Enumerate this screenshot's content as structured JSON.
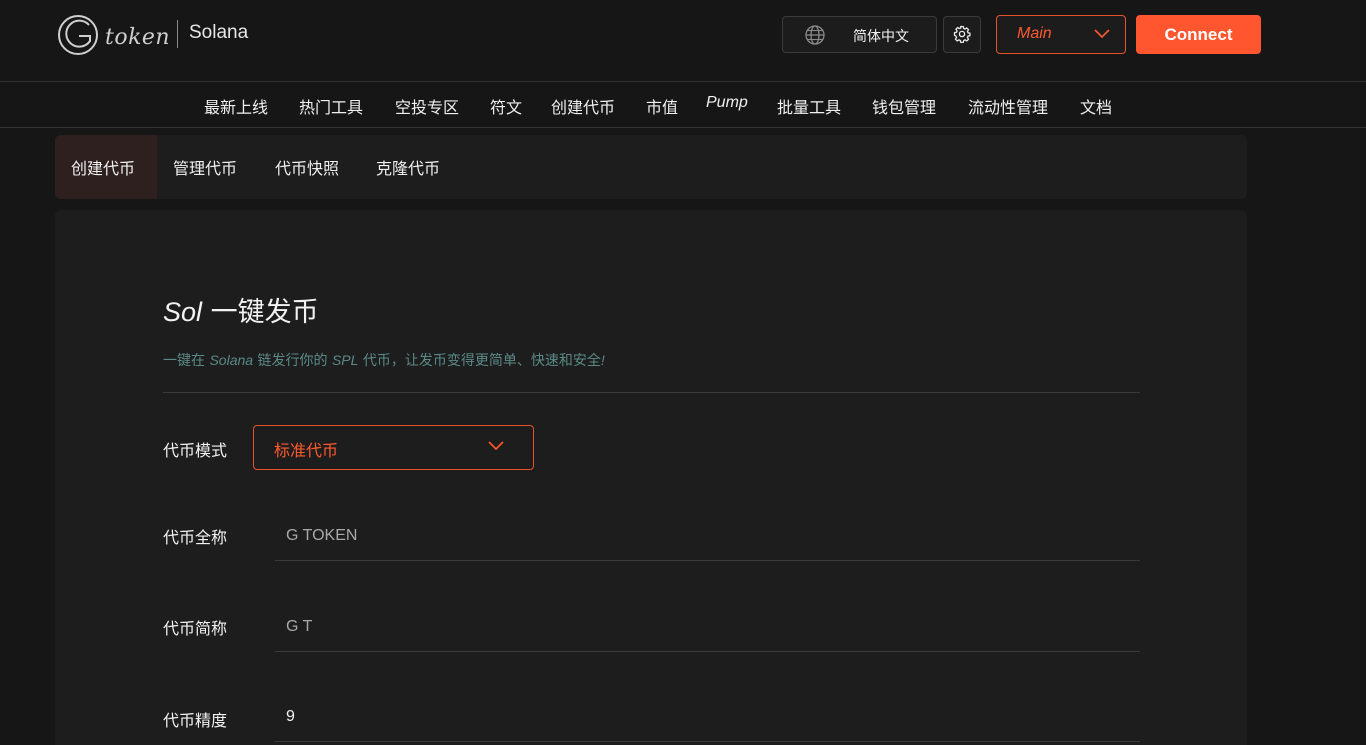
{
  "header": {
    "logo_text": "token",
    "chain": "Solana",
    "language": "简体中文",
    "network": "Main",
    "connect_label": "Connect"
  },
  "nav": {
    "items": [
      "最新上线",
      "热门工具",
      "空投专区",
      "符文",
      "创建代币",
      "市值",
      "Pump",
      "批量工具",
      "钱包管理",
      "流动性管理",
      "文档"
    ]
  },
  "subtabs": [
    "创建代币",
    "管理代币",
    "代币快照",
    "克隆代币"
  ],
  "form": {
    "title_prefix": "Sol",
    "title_rest": " 一键发币",
    "subtitle_a": "一键在 ",
    "subtitle_chain": "Solana",
    "subtitle_b": " 链发行你的 ",
    "subtitle_spl": "SPL",
    "subtitle_c": " 代币，让发币变得更简单、快速和安全",
    "subtitle_end": "!",
    "mode_label": "代币模式",
    "mode_value": "标准代币",
    "name_label": "代币全称",
    "name_placeholder": "G TOKEN",
    "symbol_label": "代币简称",
    "symbol_placeholder": "G T",
    "decimals_label": "代币精度",
    "decimals_value": "9"
  },
  "colors": {
    "accent": "#ff5630",
    "background": "#161616",
    "card": "#1d1d1d",
    "subtitle": "#5a8a86"
  }
}
